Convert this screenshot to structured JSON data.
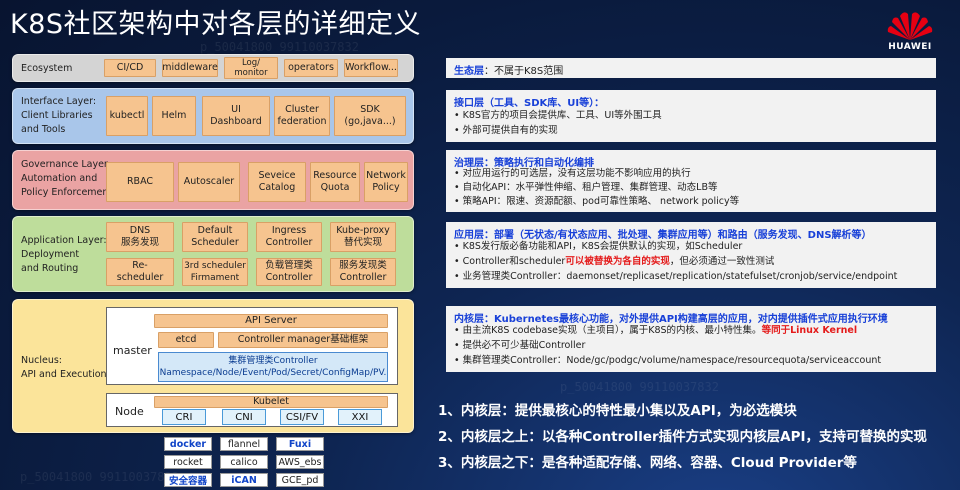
{
  "title": "K8S社区架构中对各层的详细定义",
  "logo": {
    "text": "HUAWEI",
    "color": "#e60012"
  },
  "watermark": "p_50041800 99110037832",
  "ecosystem": {
    "label": "Ecosystem",
    "items": [
      "CI/CD",
      "middleware",
      "Log/\nmonitor",
      "operators",
      "Workflow..."
    ]
  },
  "interface": {
    "label": "Interface Layer:\nClient Libraries\nand Tools",
    "items": [
      "kubectl",
      "Helm",
      "UI\nDashboard",
      "Cluster\nfederation",
      "SDK\n(go,java...)"
    ]
  },
  "governance": {
    "label": "Governance Layer:\nAutomation and\nPolicy Enforcement",
    "items": [
      "RBAC",
      "Autoscaler",
      "Seveice\nCatalog",
      "Resource\nQuota",
      "Network\nPolicy"
    ]
  },
  "application": {
    "label": "Application Layer:\nDeployment\nand Routing",
    "row1": [
      "DNS\n服务发现",
      "Default\nScheduler",
      "Ingress\nController",
      "Kube-proxy\n替代实现"
    ],
    "row2": [
      "Re-\nscheduler",
      "3rd scheduler\nFirmament",
      "负载管理类\nController",
      "服务发现类\nController"
    ]
  },
  "nucleus": {
    "label": "Nucleus:\nAPI and Execution",
    "master": "master",
    "api_server": "API Server",
    "etcd": "etcd",
    "controller_manager": "Controller manager基础框架",
    "cluster_ctrl": "集群管理类Controller\nNamespace/Node/Event/Pod/Secret/ConfigMap/PV.",
    "node": "Node",
    "kubelet": "Kubelet",
    "node_items": [
      "CRI",
      "CNI",
      "CSI/FV",
      "XXI"
    ]
  },
  "plugins": [
    {
      "label": "docker",
      "blue": true
    },
    {
      "label": "flannel",
      "blue": false
    },
    {
      "label": "Fuxi",
      "blue": true
    },
    {
      "label": "rocket",
      "blue": false
    },
    {
      "label": "calico",
      "blue": false
    },
    {
      "label": "AWS_ebs",
      "blue": false
    },
    {
      "label": "安全容器",
      "blue": true
    },
    {
      "label": "iCAN",
      "blue": true
    },
    {
      "label": "GCE_pd",
      "blue": false
    }
  ],
  "panels": {
    "eco": {
      "title": "生态层",
      "desc": "：不属于K8S范围"
    },
    "interface": {
      "title": "接口层（工具、SDK库、UI等）：",
      "bullets": [
        "K8S官方的项目会提供库、工具、UI等外围工具",
        "外部可提供自有的实现"
      ]
    },
    "governance": {
      "title": "治理层：策略执行和自动化编排",
      "bullets": [
        "对应用运行的可选层，没有这层功能不影响应用的执行",
        "自动化API：水平弹性伸缩、租户管理、集群管理、动态LB等",
        "策略API：限速、资源配额、pod可靠性策略、 network policy等"
      ]
    },
    "application": {
      "title": "应用层：部署（无状态/有状态应用、批处理、集群应用等）和路由（服务发现、DNS解析等）",
      "b1": "K8S发行版必备功能和API，K8S会提供默认的实现，如Scheduler",
      "b2_pre": "Controller和scheduler",
      "b2_red": "可以被替换为各自的实现",
      "b2_post": "，但必须通过一致性测试",
      "b3": "业务管理类Controller：daemonset/replicaset/replication/statefulset/cronjob/service/endpoint"
    },
    "nucleus": {
      "title": "内核层：Kubernetes最核心功能，对外提供API构建高层的应用，对内提供插件式应用执行环境",
      "b1_pre": "由主流K8S codebase实现（主项目），属于K8S的内核、最小特性集。",
      "b1_red": "等同于Linux  Kernel",
      "b2": "提供必不可少基础Controller",
      "b3": "集群管理类Controller：Node/gc/podgc/volume/namespace/resourcequota/serviceaccount"
    }
  },
  "summary": [
    "1、内核层：提供最核心的特性最小集以及API，为必选模块",
    "2、内核层之上：以各种Controller插件方式实现内核层API，支持可替换的实现",
    "3、内核层之下：是各种适配存储、网络、容器、Cloud  Provider等"
  ],
  "colors": {
    "ecosystem": "#d4d4d4",
    "interface": "#a9c6ea",
    "governance": "#eaa3a3",
    "application": "#bedd9b",
    "nucleus": "#fbe49a",
    "chip": "#f6c48f",
    "accent_blue": "#1840d8",
    "accent_red": "#e41b1b"
  }
}
